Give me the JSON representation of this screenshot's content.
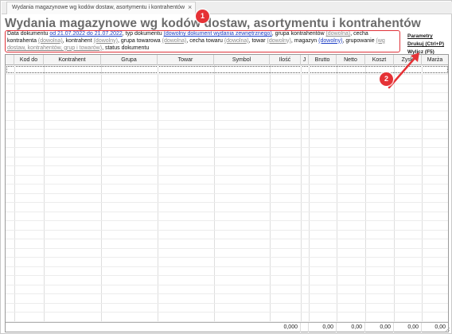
{
  "tab": {
    "title": "Wydania magazynowe wg kodów dostaw, asortymentu i kontrahentów",
    "close_glyph": "×"
  },
  "page_title": "Wydania magazynowe wg kodów dostaw, asortymentu i kontrahentów",
  "params": {
    "t1": "Data dokumentu ",
    "date_range": "od 21.07.2022 do 21.07.2022",
    "t2": ", typ dokumentu ",
    "doc_type": "(dowolny dokument wydania zewnętrznego)",
    "t3": ", grupa kontrahentów ",
    "grupa_kontrahentow": "(dowolna)",
    "t4": ", cecha kontrahenta ",
    "cecha_kontrahenta": "(dowolna)",
    "t5": ", kontrahent ",
    "kontrahent": "(dowolny)",
    "t6": ", grupa towarowa ",
    "grupa_towarowa": "(dowolna)",
    "t7": ", cecha towaru ",
    "cecha_towaru": "(dowolna)",
    "t8": ", towar ",
    "towar": "(dowolny)",
    "t9": ", magazyn ",
    "magazyn": "(dowolny)",
    "t10": ", grupowanie ",
    "grupowanie": "(wg dostaw, kontrahentów, grup i towarów)",
    "t11": ", status dokumentu"
  },
  "right_links": {
    "parametry": "Parametry",
    "druk": "Drukuj (Ctrl+P)",
    "wylicz": "Wylicz (F5)"
  },
  "annotations": {
    "badge1": "1",
    "badge2": "2",
    "color": "#e53236"
  },
  "columns": [
    "Kod do",
    "Kontrahent",
    "Grupa",
    "Towar",
    "Symbol",
    "Ilość",
    "J",
    "Brutto",
    "Netto",
    "Koszt",
    "Zysk",
    "Marża"
  ],
  "totals": {
    "ilosc": "0,000",
    "brutto": "0,00",
    "netto": "0,00",
    "koszt": "0,00",
    "zysk": "0,00",
    "marza": "0,00"
  }
}
